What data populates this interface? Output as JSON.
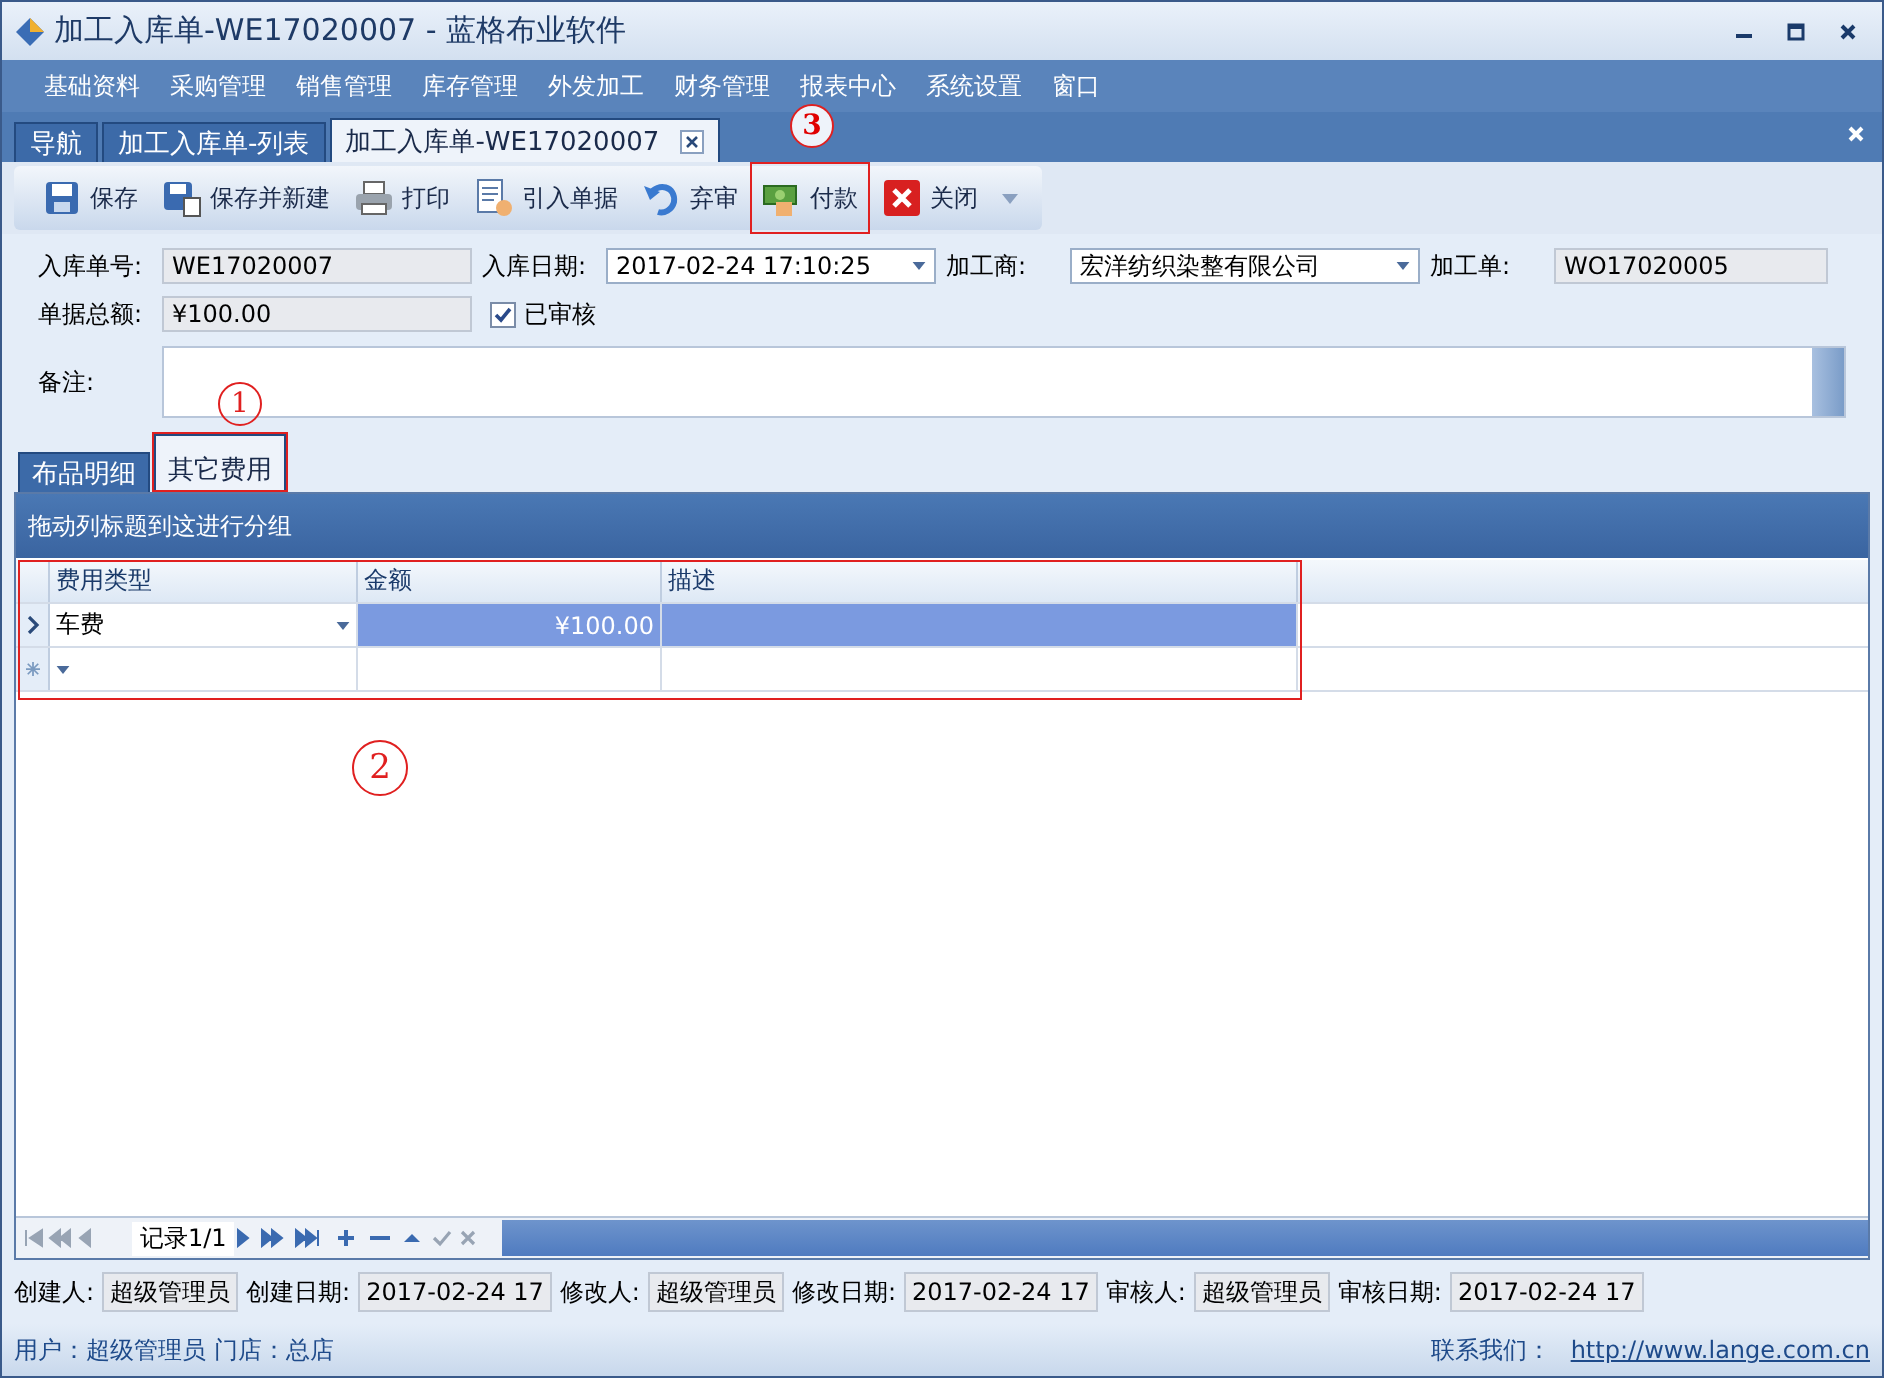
{
  "window": {
    "title": "加工入库单-WE17020007 - 蓝格布业软件"
  },
  "menu": [
    "基础资料",
    "采购管理",
    "销售管理",
    "库存管理",
    "外发加工",
    "财务管理",
    "报表中心",
    "系统设置",
    "窗口"
  ],
  "doc_tabs": [
    {
      "label": "导航",
      "selected": false,
      "closable": false
    },
    {
      "label": "加工入库单-列表",
      "selected": false,
      "closable": false
    },
    {
      "label": "加工入库单-WE17020007",
      "selected": true,
      "closable": true
    }
  ],
  "toolbar": [
    {
      "label": "保存",
      "kind": "save"
    },
    {
      "label": "保存并新建",
      "kind": "save-new"
    },
    {
      "label": "打印",
      "kind": "print"
    },
    {
      "label": "引入单据",
      "kind": "import"
    },
    {
      "label": "弃审",
      "kind": "undo"
    },
    {
      "label": "付款",
      "kind": "pay",
      "annotation": "3"
    },
    {
      "label": "关闭",
      "kind": "close",
      "dropdown": true
    }
  ],
  "form": {
    "fields": [
      {
        "label": "入库单号:",
        "value": "WE17020007",
        "kind": "readonly"
      },
      {
        "label": "入库日期:",
        "value": "2017-02-24 17:10:25",
        "kind": "dropdown"
      },
      {
        "label": "加工商:",
        "value": "宏洋纺织染整有限公司",
        "kind": "dropdown"
      },
      {
        "label": "加工单:",
        "value": "WO17020005",
        "kind": "readonly"
      },
      {
        "label": "单据总额:",
        "value": "¥100.00",
        "kind": "readonly"
      }
    ],
    "audited": {
      "label": "已审核",
      "checked": true
    },
    "remark": {
      "label": "备注:"
    }
  },
  "detail_tabs": [
    {
      "label": "布品明细",
      "selected": false
    },
    {
      "label": "其它费用",
      "selected": true,
      "annotation": "1"
    }
  ],
  "group_panel": "拖动列标题到这进行分组",
  "grid": {
    "annotation": "2",
    "columns": [
      "费用类型",
      "金额",
      "描述"
    ],
    "rows": [
      {
        "cells": [
          "车费",
          "¥100.00"
        ],
        "selected": true
      }
    ],
    "new_row": true
  },
  "navigator": {
    "record": "记录1/1"
  },
  "audit_fields": [
    {
      "label": "创建人:",
      "value": "超级管理员"
    },
    {
      "label": "创建日期:",
      "value": "2017-02-24 17"
    },
    {
      "label": "修改人:",
      "value": "超级管理员"
    },
    {
      "label": "修改日期:",
      "value": "2017-02-24 17"
    },
    {
      "label": "审核人:",
      "value": "超级管理员"
    },
    {
      "label": "审核日期:",
      "value": "2017-02-24 17"
    }
  ],
  "status_bar": {
    "user": "用户：超级管理员  门店：总店",
    "contact_label": "联系我们：",
    "link": "http://www.lange.com.cn"
  }
}
